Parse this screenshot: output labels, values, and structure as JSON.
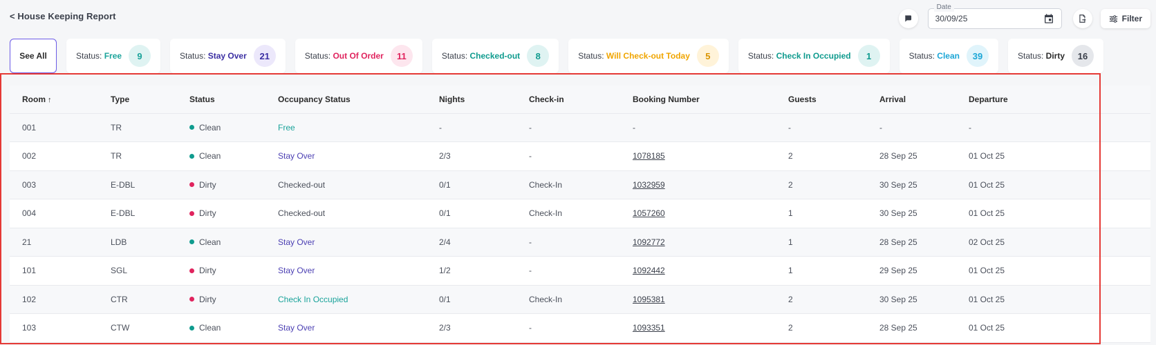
{
  "header": {
    "back_label": "< House Keeping Report",
    "date_label": "Date",
    "date_value": "30/09/25",
    "filter_label": "Filter"
  },
  "chips": [
    {
      "label": "See All"
    },
    {
      "prefix": "Status: ",
      "status": "Free",
      "count": "9",
      "color": "#1aa39a",
      "badge_bg": "#dff3f2",
      "badge_fg": "#1aa39a"
    },
    {
      "prefix": "Status: ",
      "status": "Stay Over",
      "count": "21",
      "color": "#3b2fa3",
      "badge_bg": "#ece8fb",
      "badge_fg": "#3b2fa3"
    },
    {
      "prefix": "Status: ",
      "status": "Out Of Order",
      "count": "11",
      "color": "#e0245e",
      "badge_bg": "#fde6ee",
      "badge_fg": "#e0245e"
    },
    {
      "prefix": "Status: ",
      "status": "Checked-out",
      "count": "8",
      "color": "#0f9b8e",
      "badge_bg": "#dff3f2",
      "badge_fg": "#0f9b8e"
    },
    {
      "prefix": "Status: ",
      "status": "Will Check-out Today",
      "count": "5",
      "color": "#f0a500",
      "badge_bg": "#fff3d9",
      "badge_fg": "#d99400"
    },
    {
      "prefix": "Status: ",
      "status": "Check In Occupied",
      "count": "1",
      "color": "#0f9b8e",
      "badge_bg": "#dff3f2",
      "badge_fg": "#0f9b8e"
    },
    {
      "prefix": "Status: ",
      "status": "Clean",
      "count": "39",
      "color": "#1ba6d6",
      "badge_bg": "#e0f4fb",
      "badge_fg": "#1ba6d6"
    },
    {
      "prefix": "Status: ",
      "status": "Dirty",
      "count": "16",
      "color": "#2b2b2b",
      "badge_bg": "#e5e7eb",
      "badge_fg": "#3a3f4a"
    }
  ],
  "table": {
    "columns": [
      "Room",
      "Type",
      "Status",
      "Occupancy Status",
      "Nights",
      "Check-in",
      "Booking Number",
      "Guests",
      "Arrival",
      "Departure"
    ],
    "sort_glyph": "↑",
    "rows": [
      {
        "room": "001",
        "type": "TR",
        "status": "Clean",
        "status_color": "#0f9b8e",
        "occupancy": "Free",
        "occ_color": "#1aa39a",
        "nights": "-",
        "checkin": "-",
        "booking": "-",
        "guests": "-",
        "arrival": "-",
        "departure": "-"
      },
      {
        "room": "002",
        "type": "TR",
        "status": "Clean",
        "status_color": "#0f9b8e",
        "occupancy": "Stay Over",
        "occ_color": "#4b3fb3",
        "nights": "2/3",
        "checkin": "-",
        "booking": "1078185",
        "guests": "2",
        "arrival": "28 Sep 25",
        "departure": "01 Oct 25"
      },
      {
        "room": "003",
        "type": "E-DBL",
        "status": "Dirty",
        "status_color": "#e0245e",
        "occupancy": "Checked-out",
        "occ_color": "#4a4f5a",
        "nights": "0/1",
        "checkin": "Check-In",
        "booking": "1032959",
        "guests": "2",
        "arrival": "30 Sep 25",
        "departure": "01 Oct 25"
      },
      {
        "room": "004",
        "type": "E-DBL",
        "status": "Dirty",
        "status_color": "#e0245e",
        "occupancy": "Checked-out",
        "occ_color": "#4a4f5a",
        "nights": "0/1",
        "checkin": "Check-In",
        "booking": "1057260",
        "guests": "1",
        "arrival": "30 Sep 25",
        "departure": "01 Oct 25"
      },
      {
        "room": "21",
        "type": "LDB",
        "status": "Clean",
        "status_color": "#0f9b8e",
        "occupancy": "Stay Over",
        "occ_color": "#4b3fb3",
        "nights": "2/4",
        "checkin": "-",
        "booking": "1092772",
        "guests": "1",
        "arrival": "28 Sep 25",
        "departure": "02 Oct 25"
      },
      {
        "room": "101",
        "type": "SGL",
        "status": "Dirty",
        "status_color": "#e0245e",
        "occupancy": "Stay Over",
        "occ_color": "#4b3fb3",
        "nights": "1/2",
        "checkin": "-",
        "booking": "1092442",
        "guests": "1",
        "arrival": "29 Sep 25",
        "departure": "01 Oct 25"
      },
      {
        "room": "102",
        "type": "CTR",
        "status": "Dirty",
        "status_color": "#e0245e",
        "occupancy": "Check In Occupied",
        "occ_color": "#1aa39a",
        "nights": "0/1",
        "checkin": "Check-In",
        "booking": "1095381",
        "guests": "2",
        "arrival": "30 Sep 25",
        "departure": "01 Oct 25"
      },
      {
        "room": "103",
        "type": "CTW",
        "status": "Clean",
        "status_color": "#0f9b8e",
        "occupancy": "Stay Over",
        "occ_color": "#4b3fb3",
        "nights": "2/3",
        "checkin": "-",
        "booking": "1093351",
        "guests": "2",
        "arrival": "28 Sep 25",
        "departure": "01 Oct 25"
      }
    ]
  }
}
